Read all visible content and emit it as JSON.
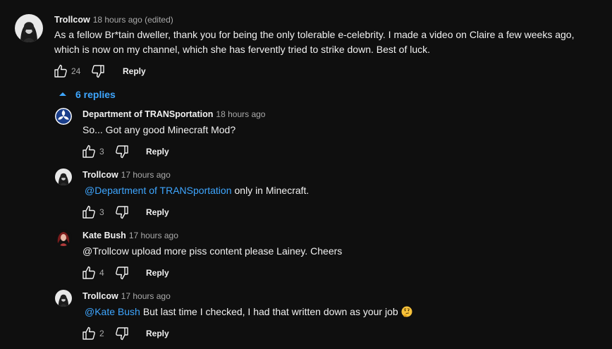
{
  "comment": {
    "author": "Trollcow",
    "time": "18 hours ago (edited)",
    "text_line1": "As a fellow Br*tain dweller, thank you for being the only tolerable e-celebrity. I made a video on Claire a few weeks ago,",
    "text_line2": "which is now on my channel, which she has fervently tried to strike down. Best of luck.",
    "likes": "24",
    "reply_label": "Reply"
  },
  "replies_toggle": {
    "label": "6 replies",
    "icon": "caret-up-icon"
  },
  "replies": [
    {
      "author": "Department of TRANSportation",
      "time": "18 hours ago",
      "mention": "",
      "text": "So... Got any good Minecraft Mod?",
      "likes": "3",
      "reply_label": "Reply",
      "avatar": "dot-logo-avatar"
    },
    {
      "author": "Trollcow",
      "time": "17 hours ago",
      "mention": "@Department of TRANSportation",
      "text": "only in Minecraft.",
      "likes": "3",
      "reply_label": "Reply",
      "avatar": "trollcow-avatar"
    },
    {
      "author": "Kate Bush",
      "time": "17 hours ago",
      "mention": "",
      "text": "@Trollcow upload more piss content please Lainey. Cheers",
      "likes": "4",
      "reply_label": "Reply",
      "avatar": "kate-bush-avatar"
    },
    {
      "author": "Trollcow",
      "time": "17 hours ago",
      "mention": "@Kate Bush",
      "text": "But last time I checked, I had that written down as your job",
      "emoji": "thinking-face-emoji",
      "likes": "2",
      "reply_label": "Reply",
      "avatar": "trollcow-avatar"
    }
  ],
  "colors": {
    "background": "#0f0f0f",
    "text": "#f1f1f1",
    "secondary": "#aaaaaa",
    "link": "#3ea6ff"
  }
}
